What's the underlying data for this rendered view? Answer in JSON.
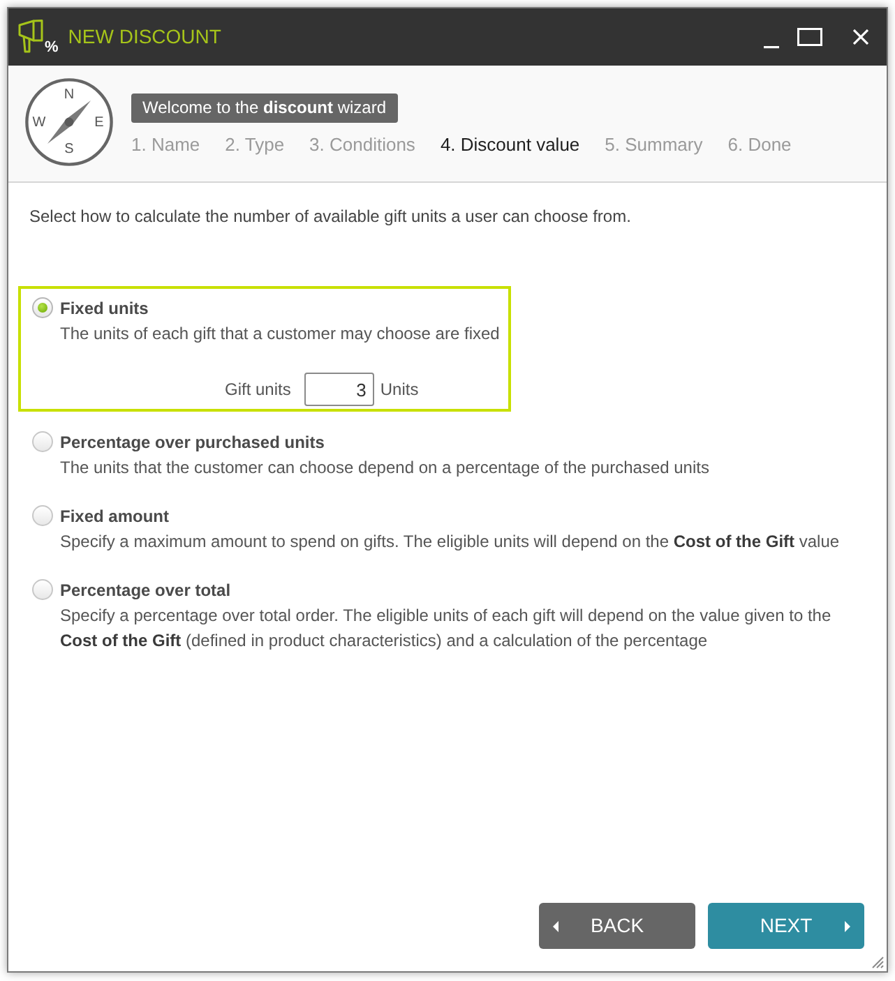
{
  "window": {
    "title": "NEW DISCOUNT",
    "icon_badge": "%"
  },
  "header": {
    "compass_letters": [
      "N",
      "E",
      "S",
      "W"
    ],
    "welcome": "Welcome to the **discount** wizard",
    "steps": [
      {
        "label": "1. Name",
        "selected": false
      },
      {
        "label": "2. Type",
        "selected": false
      },
      {
        "label": "3. Conditions",
        "selected": false
      },
      {
        "label": "4. Discount value",
        "selected": true
      },
      {
        "label": "5. Summary",
        "selected": false
      },
      {
        "label": "6. Done",
        "selected": false
      }
    ]
  },
  "intro": "Select how to calculate the number of available gift units a user can choose from.",
  "options": [
    {
      "title": "Fixed units",
      "description": "The units of each gift that a customer may choose are fixed",
      "selected": true,
      "input": {
        "label": "Gift units",
        "value": "3",
        "unit": "Units"
      }
    },
    {
      "title": "Percentage over purchased units",
      "description": "The units that the customer can choose depend on a percentage of the purchased units",
      "selected": false
    },
    {
      "title": "Fixed amount",
      "description": "Specify a maximum amount to spend on gifts. The eligible units will depend on the **Cost of the Gift** value",
      "selected": false
    },
    {
      "title": "Percentage over total",
      "description": "Specify a percentage over total order. The eligible units of each gift will depend on the value given to the **Cost of the Gift** (defined in product characteristics) and a calculation of the percentage",
      "selected": false
    }
  ],
  "buttons": [
    {
      "kind": "back",
      "label": "BACK"
    },
    {
      "kind": "next",
      "label": "NEXT"
    }
  ]
}
